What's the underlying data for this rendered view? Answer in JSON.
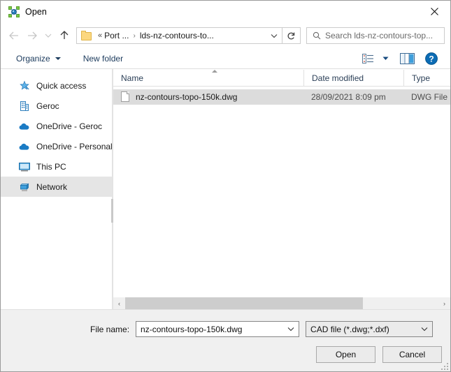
{
  "window": {
    "title": "Open",
    "icon": "node-hub-icon",
    "close_label": "✕"
  },
  "navigation": {
    "back_label": "←",
    "forward_label": "→",
    "recent_label": "⌄",
    "up_label": "↑",
    "refresh_label": "↻",
    "breadcrumb": {
      "overflow": "«",
      "items": [
        "Port ...",
        "lds-nz-contours-to..."
      ],
      "separator": "›"
    },
    "address_dropdown": "⌄"
  },
  "search": {
    "placeholder": "Search lds-nz-contours-top...",
    "icon": "search-icon"
  },
  "toolbar": {
    "organize_label": "Organize",
    "new_folder_label": "New folder",
    "view_icon": "list-view-icon",
    "view_dropdown": "▼",
    "preview_pane_icon": "preview-pane-icon",
    "help_icon": "help-icon",
    "help_glyph": "?"
  },
  "sidebar": {
    "items": [
      {
        "label": "Quick access",
        "icon": "star-pin-icon",
        "selected": false
      },
      {
        "label": "Geroc",
        "icon": "office-building-icon",
        "selected": false
      },
      {
        "label": "OneDrive - Geroc",
        "icon": "cloud-icon",
        "selected": false
      },
      {
        "label": "OneDrive - Personal",
        "icon": "cloud-icon",
        "selected": false
      },
      {
        "label": "This PC",
        "icon": "monitor-icon",
        "selected": false
      },
      {
        "label": "Network",
        "icon": "network-icon",
        "selected": true
      }
    ]
  },
  "file_list": {
    "columns": [
      "Name",
      "Date modified",
      "Type"
    ],
    "sort_column": "Name",
    "sort_direction": "ascending",
    "rows": [
      {
        "name": "nz-contours-topo-150k.dwg",
        "date_modified": "28/09/2021 8:09 pm",
        "type": "DWG File",
        "icon": "document-icon",
        "selected": true
      }
    ],
    "scroll_left_arrow": "‹",
    "scroll_right_arrow": "›"
  },
  "footer": {
    "file_name_label": "File name:",
    "file_name_value": "nz-contours-topo-150k.dwg",
    "file_name_dropdown": "⌄",
    "file_type_value": "CAD file (*.dwg;*.dxf)",
    "file_type_dropdown": "⌄",
    "open_label": "Open",
    "cancel_label": "Cancel"
  },
  "colors": {
    "accent_blue": "#0078d7",
    "folder_yellow": "#fcd77f",
    "selection_gray": "#dcdcdc",
    "footer_gray": "#f0f0f0",
    "header_text": "#2b3f57"
  }
}
